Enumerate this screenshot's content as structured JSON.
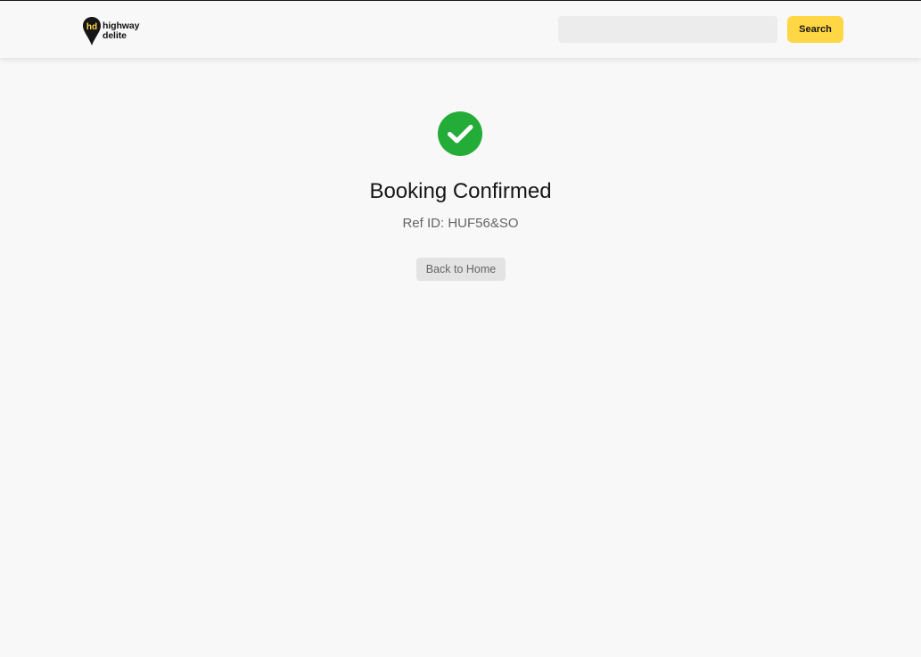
{
  "header": {
    "logo": {
      "line1": "highway",
      "line2": "delite",
      "monogram": "hd",
      "icon": "location-pin-logo-icon"
    },
    "search": {
      "placeholder": "",
      "value": "",
      "button_label": "Search"
    }
  },
  "confirmation": {
    "icon": "check-circle-icon",
    "title": "Booking Confirmed",
    "ref_text": "Ref ID: HUF56&SO",
    "back_button_label": "Back to Home"
  },
  "colors": {
    "accent": "#ffd643",
    "success": "#24ac39",
    "background": "#f8f8f8",
    "text": "#161616",
    "muted_text": "#656565"
  }
}
